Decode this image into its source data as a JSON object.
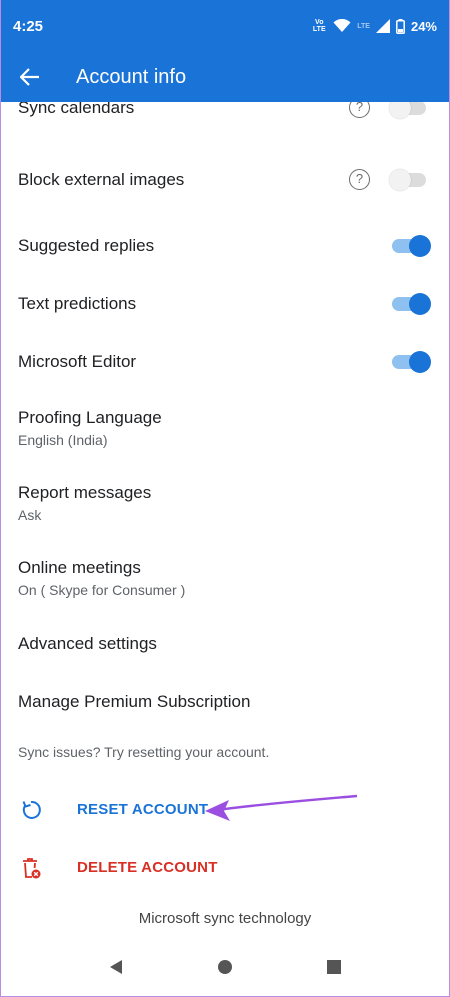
{
  "status": {
    "time": "4:25",
    "volte": "Vo LTE",
    "lte": "LTE",
    "battery": "24%"
  },
  "appbar": {
    "title": "Account info"
  },
  "settings": [
    {
      "label": "Sync calendars",
      "help": "?",
      "toggle": "off"
    },
    {
      "label": "Block external images",
      "help": "?",
      "toggle": "off"
    },
    {
      "label": "Suggested replies",
      "toggle": "on"
    },
    {
      "label": "Text predictions",
      "toggle": "on"
    },
    {
      "label": "Microsoft Editor",
      "toggle": "on"
    },
    {
      "label": "Proofing Language",
      "sub": "English (India)"
    },
    {
      "label": "Report messages",
      "sub": "Ask"
    },
    {
      "label": "Online meetings",
      "sub": "On ( Skype for Consumer )"
    },
    {
      "label": "Advanced settings"
    },
    {
      "label": "Manage Premium Subscription"
    }
  ],
  "sync_note": "Sync issues? Try resetting your account.",
  "actions": {
    "reset": {
      "label": "RESET ACCOUNT",
      "color": "#1a73d6",
      "icon": "reset-icon"
    },
    "delete": {
      "label": "DELETE ACCOUNT",
      "color": "#d93025",
      "icon": "delete-account-icon"
    }
  },
  "footer": "Microsoft sync technology",
  "colors": {
    "brand": "#1a73d6",
    "annotation_arrow": "#9b4fe0"
  }
}
